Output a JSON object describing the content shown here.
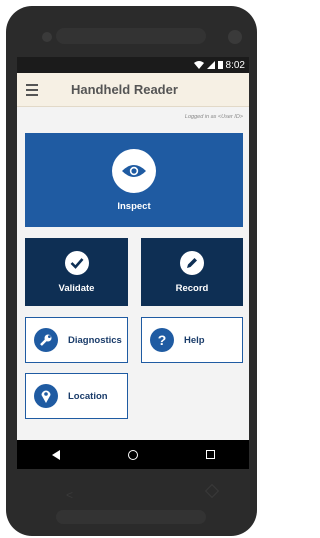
{
  "status": {
    "time": "8:02"
  },
  "appbar": {
    "title": "Handheld Reader"
  },
  "session": {
    "logged_in_text": "Logged in as <User ID>"
  },
  "tiles": {
    "inspect": "Inspect",
    "validate": "Validate",
    "record": "Record",
    "diagnostics": "Diagnostics",
    "help": "Help",
    "location": "Location"
  },
  "icons": {
    "menu": "hamburger-icon",
    "inspect": "eye-icon",
    "validate": "checkmark-icon",
    "record": "pencil-icon",
    "diagnostics": "wrench-icon",
    "help": "question-icon",
    "location": "map-pin-icon",
    "back": "back-icon",
    "home": "home-icon",
    "recent": "recents-icon"
  },
  "colors": {
    "primary": "#1f5ba2",
    "dark": "#0e2f54",
    "appbar_bg": "#f6f0e4",
    "screen_bg": "#f3f3f3"
  }
}
